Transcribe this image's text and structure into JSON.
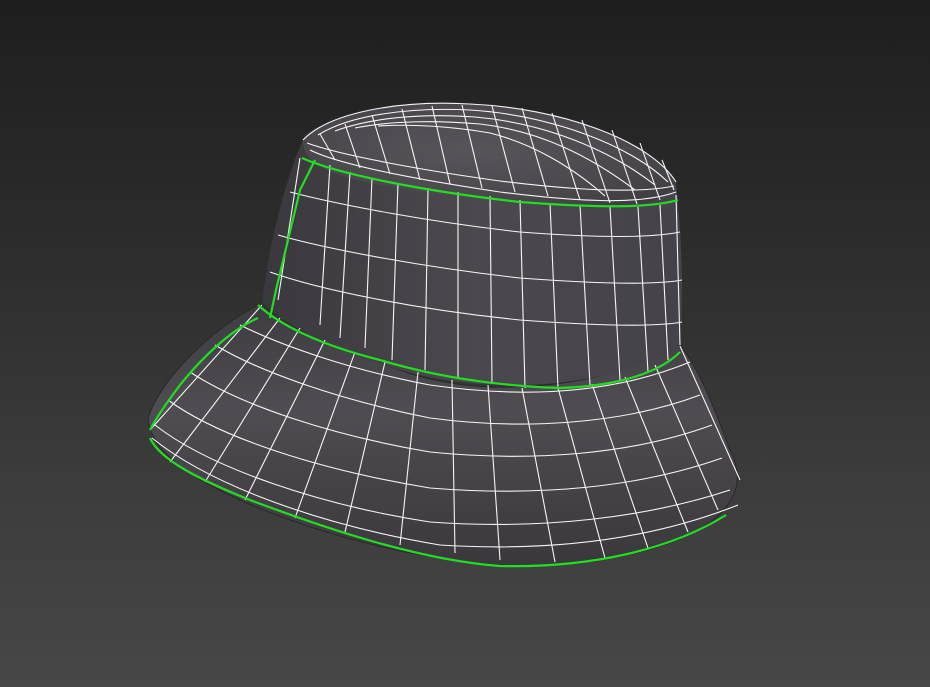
{
  "viewport": {
    "background_top": "#1e1e1e",
    "background_bottom": "#474747"
  },
  "model": {
    "object": "bucket-hat",
    "shading": "smooth-shaded-with-wireframe",
    "mesh_color": "#4a474d",
    "wire_color": "#ffffff",
    "selected_edge_color": "#22dd22",
    "selection_mode": "edge-loop"
  }
}
